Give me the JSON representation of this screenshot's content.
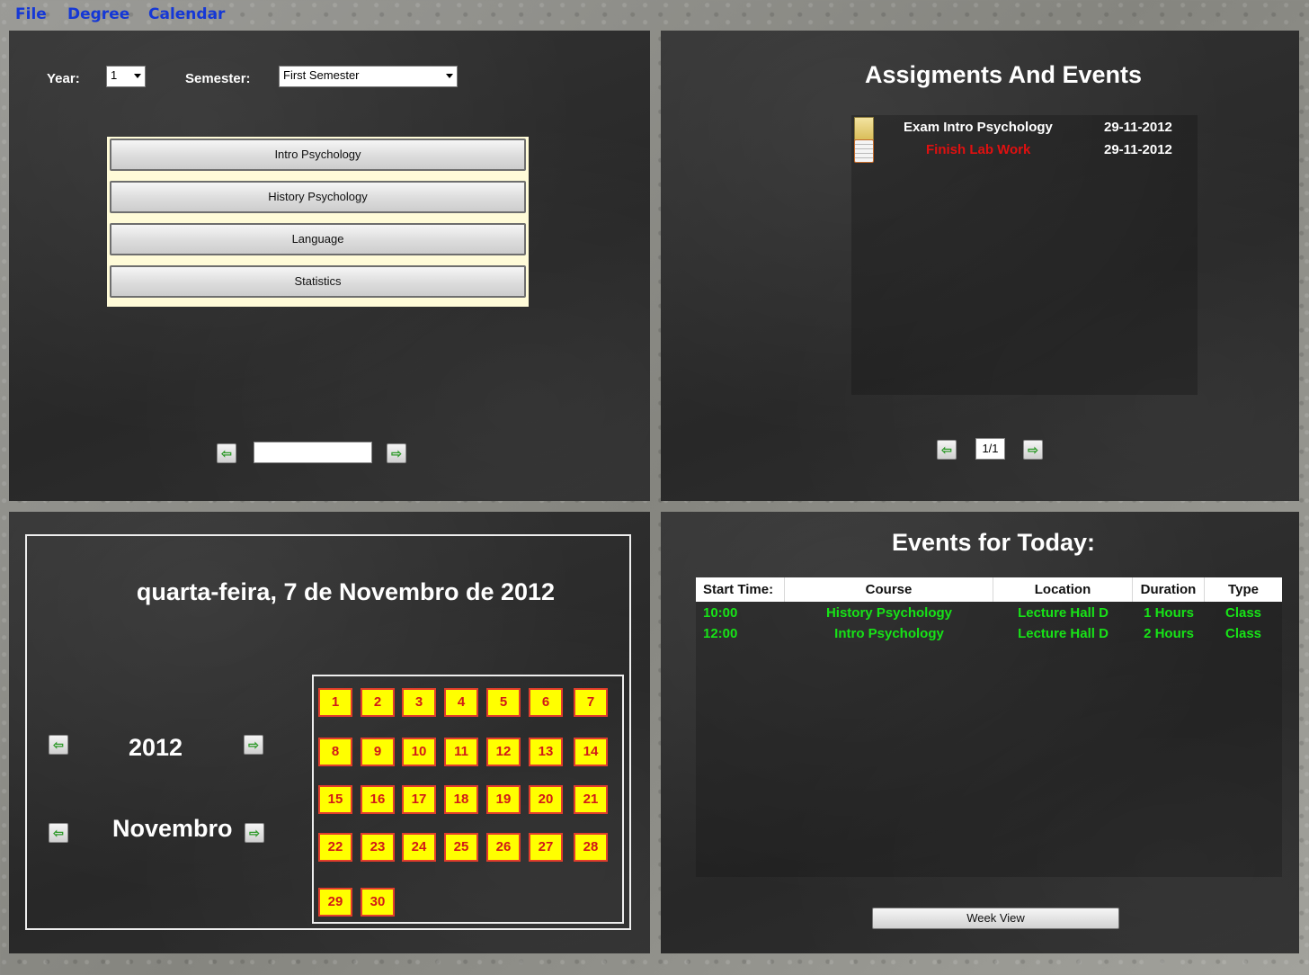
{
  "menu": {
    "file": "File",
    "degree": "Degree",
    "calendar": "Calendar"
  },
  "courses_panel": {
    "year_label": "Year:",
    "year_value": "1",
    "semester_label": "Semester:",
    "semester_value": "First Semester",
    "courses": [
      "Intro Psychology",
      "History Psychology",
      "Language",
      "Statistics"
    ],
    "page_text": ""
  },
  "assignments_panel": {
    "title": "Assigments And Events",
    "items": [
      {
        "icon": "sticky-note-icon",
        "name": "Exam Intro Psychology",
        "date": "29-11-2012",
        "color": "#ffffff"
      },
      {
        "icon": "checklist-icon",
        "name": "Finish Lab Work",
        "date": "29-11-2012",
        "color": "#e01010"
      }
    ],
    "page": "1/1"
  },
  "calendar_panel": {
    "date_title": "quarta-feira, 7 de Novembro de 2012",
    "year": "2012",
    "month": "Novembro",
    "days": [
      "1",
      "2",
      "3",
      "4",
      "5",
      "6",
      "7",
      "8",
      "9",
      "10",
      "11",
      "12",
      "13",
      "14",
      "15",
      "16",
      "17",
      "18",
      "19",
      "20",
      "21",
      "22",
      "23",
      "24",
      "25",
      "26",
      "27",
      "28",
      "29",
      "30"
    ],
    "day_bg": "#ffff00",
    "day_border": "#e23d2c"
  },
  "today_panel": {
    "title": "Events for Today:",
    "headers": [
      "Start Time:",
      "Course",
      "Location",
      "Duration",
      "Type"
    ],
    "rows": [
      [
        "10:00",
        "History Psychology",
        "Lecture Hall D",
        "1 Hours",
        "Class"
      ],
      [
        "12:00",
        "Intro Psychology",
        "Lecture Hall D",
        "2 Hours",
        "Class"
      ]
    ],
    "row_color": "#17e317",
    "week_view": "Week View"
  }
}
